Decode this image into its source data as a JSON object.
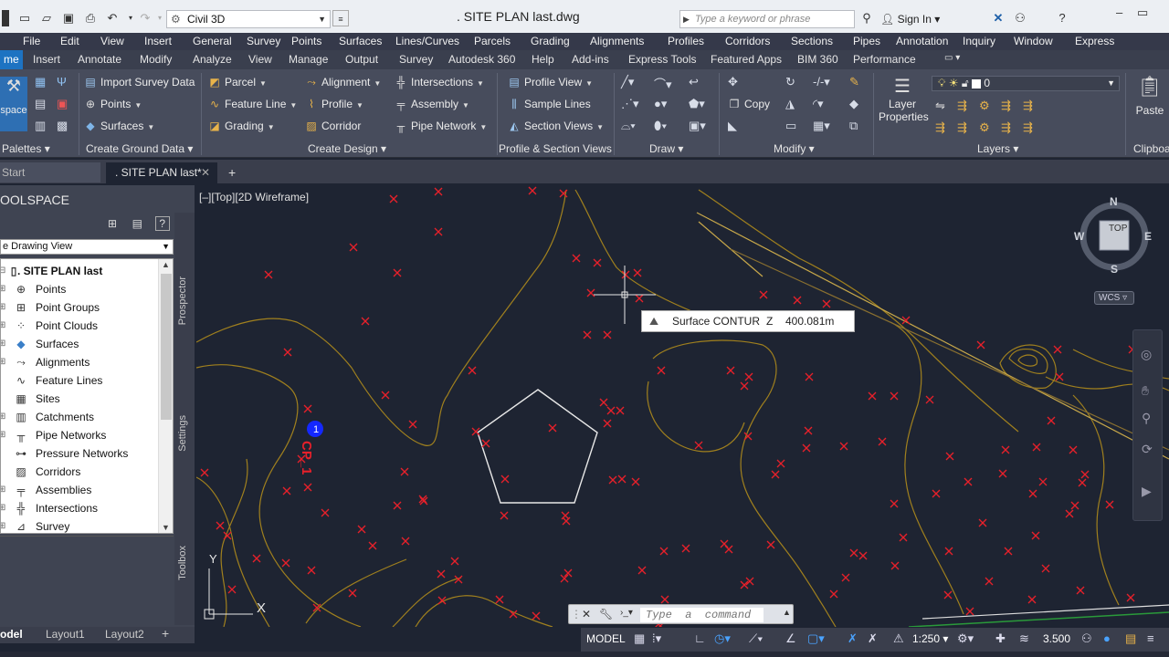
{
  "title_bar": {
    "workspace": "Civil 3D",
    "title": ". SITE PLAN last.dwg",
    "search_placeholder": "Type a keyword or phrase",
    "sign_in": "Sign In"
  },
  "menu": [
    "File",
    "Edit",
    "View",
    "Insert",
    "General",
    "Survey",
    "Points",
    "Surfaces",
    "Lines/Curves",
    "Parcels",
    "Grading",
    "Alignments",
    "Profiles",
    "Corridors",
    "Sections",
    "Pipes",
    "Annotation",
    "Inquiry",
    "Window",
    "Express"
  ],
  "ribbon_tabs": {
    "active": "me",
    "items": [
      "Insert",
      "Annotate",
      "Modify",
      "Analyze",
      "View",
      "Manage",
      "Output",
      "Survey",
      "Autodesk 360",
      "Help",
      "Add-ins",
      "Express Tools",
      "Featured Apps",
      "BIM 360",
      "Performance"
    ]
  },
  "ribbon": {
    "toolspace_label": "space",
    "palettes_label": "Palettes",
    "ground": {
      "title": "Create Ground Data",
      "import": "Import Survey Data",
      "points": "Points",
      "surfaces": "Surfaces"
    },
    "design": {
      "title": "Create Design",
      "parcel": "Parcel",
      "feature_line": "Feature Line",
      "grading": "Grading",
      "alignment": "Alignment",
      "profile": "Profile",
      "corridor": "Corridor",
      "intersections": "Intersections",
      "assembly": "Assembly",
      "pipe_network": "Pipe Network"
    },
    "profile_section": {
      "title": "Profile & Section Views",
      "profile_view": "Profile View",
      "sample_lines": "Sample Lines",
      "section_views": "Section Views"
    },
    "draw": {
      "title": "Draw"
    },
    "modify": {
      "title": "Modify",
      "copy": "Copy"
    },
    "layers": {
      "title": "Layers",
      "layer_properties_1": "Layer",
      "layer_properties_2": "Properties",
      "current_layer": "0"
    },
    "clipboard": {
      "title": "Clipboa",
      "paste": "Paste"
    }
  },
  "doc_tabs": {
    "start": "Start",
    "active": ". SITE PLAN last*"
  },
  "toolspace": {
    "title": "OOLSPACE",
    "view": "e Drawing View",
    "tree": [
      ". SITE PLAN last",
      "Points",
      "Point Groups",
      "Point Clouds",
      "Surfaces",
      "Alignments",
      "Feature Lines",
      "Sites",
      "Catchments",
      "Pipe Networks",
      "Pressure Networks",
      "Corridors",
      "Assemblies",
      "Intersections",
      "Survey"
    ],
    "side_tabs": [
      "Prospector",
      "Settings",
      "Toolbox"
    ]
  },
  "layout_tabs": [
    "odel",
    "Layout1",
    "Layout2"
  ],
  "viewport": {
    "label": "[–][Top][2D Wireframe]",
    "compass": {
      "n": "N",
      "s": "S",
      "e": "E",
      "w": "W",
      "cube": "TOP"
    },
    "wcs": "WCS",
    "tooltip": {
      "name": "Surface CONTUR",
      "z_label": "Z",
      "value": "400.081m"
    },
    "cp_label": "CP_1",
    "y_axis": "Y",
    "x_axis": "X"
  },
  "command": {
    "placeholder": "Type  a  command"
  },
  "status": {
    "model": "MODEL",
    "scale": "1:250",
    "anno": "3.500"
  },
  "colors": {
    "point": "#e8202a",
    "contour": "#a0801e",
    "pentagon": "#e8e8e8",
    "accent": "#1d73c2"
  }
}
